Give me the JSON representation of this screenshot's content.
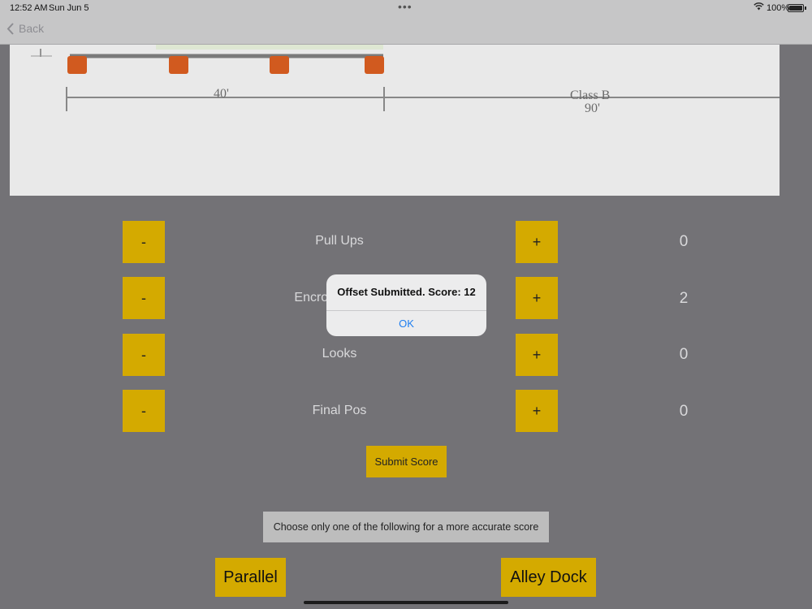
{
  "status_bar": {
    "time": "12:52 AM",
    "date": "Sun Jun 5",
    "battery": "100%"
  },
  "nav": {
    "back_label": "Back"
  },
  "diagram": {
    "label_40": "40'",
    "label_class": "Class B",
    "label_90": "90'"
  },
  "rows": [
    {
      "minus": "-",
      "label": "Pull Ups",
      "plus": "+",
      "value": "0"
    },
    {
      "minus": "-",
      "label": "Encroachments",
      "plus": "+",
      "value": "2"
    },
    {
      "minus": "-",
      "label": "Looks",
      "plus": "+",
      "value": "0"
    },
    {
      "minus": "-",
      "label": "Final Pos",
      "plus": "+",
      "value": "0"
    }
  ],
  "submit_label": "Submit Score",
  "hint": "Choose only one of the following for a more accurate score",
  "options": {
    "parallel": "Parallel",
    "alley_dock": "Alley Dock"
  },
  "alert": {
    "message": "Offset Submitted. Score: 12",
    "ok": "OK"
  },
  "colors": {
    "accent": "#d4aa00",
    "background": "#737276",
    "link": "#1e7ef0"
  }
}
